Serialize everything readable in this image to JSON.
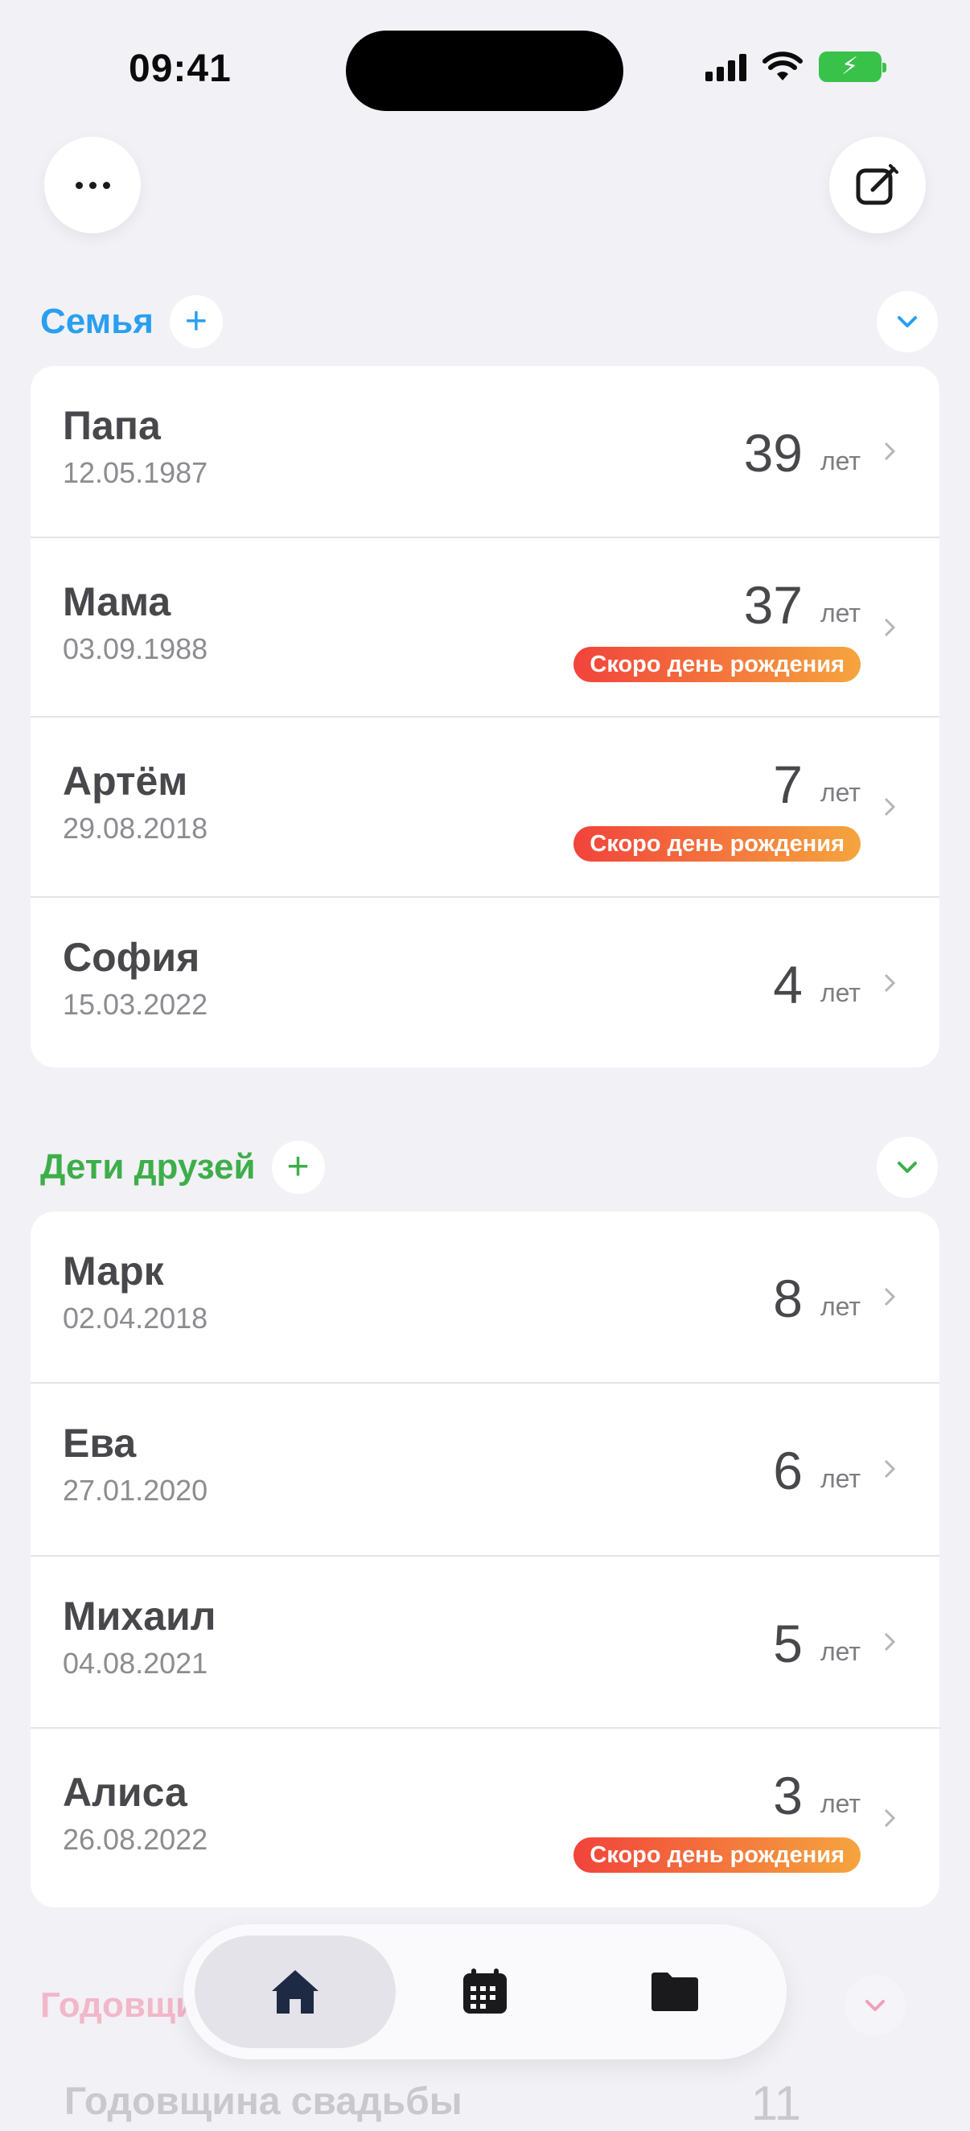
{
  "status_bar": {
    "time": "09:41"
  },
  "header": {
    "more_icon": "ellipsis-icon",
    "edit_icon": "compose-icon"
  },
  "sections": [
    {
      "title": "Семья",
      "color": "#2a9ff0",
      "add_icon": "plus-icon",
      "collapse_icon": "chevron-down-icon",
      "rows": [
        {
          "name": "Папа",
          "date": "12.05.1987",
          "age": "39",
          "unit": "лет"
        },
        {
          "name": "Мама",
          "date": "03.09.1988",
          "age": "37",
          "unit": "лет",
          "badge": "Скоро день рождения"
        },
        {
          "name": "Артём",
          "date": "29.08.2018",
          "age": "7",
          "unit": "лет",
          "badge": "Скоро день рождения"
        },
        {
          "name": "София",
          "date": "15.03.2022",
          "age": "4",
          "unit": "лет"
        }
      ]
    },
    {
      "title": "Дети друзей",
      "color": "#3eae4a",
      "add_icon": "plus-icon",
      "collapse_icon": "chevron-down-icon",
      "rows": [
        {
          "name": "Марк",
          "date": "02.04.2018",
          "age": "8",
          "unit": "лет"
        },
        {
          "name": "Ева",
          "date": "27.01.2020",
          "age": "6",
          "unit": "лет"
        },
        {
          "name": "Михаил",
          "date": "04.08.2021",
          "age": "5",
          "unit": "лет"
        },
        {
          "name": "Алиса",
          "date": "26.08.2022",
          "age": "3",
          "unit": "лет",
          "badge": "Скоро день рождения"
        }
      ]
    }
  ],
  "faded_section": {
    "title": "Годовщины",
    "row_name": "Годовщина свадьбы",
    "row_age": "11",
    "color": "#f0a0b8"
  },
  "tabbar": {
    "tabs": [
      {
        "icon": "home-icon",
        "active": true
      },
      {
        "icon": "calendar-icon",
        "active": false
      },
      {
        "icon": "folder-icon",
        "active": false
      }
    ]
  }
}
